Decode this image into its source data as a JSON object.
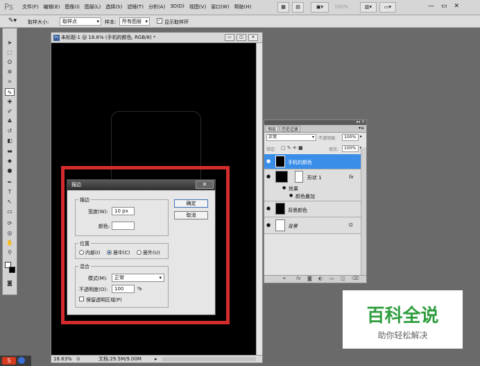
{
  "app": {
    "logo": "Ps"
  },
  "menu": {
    "items": [
      "文件(F)",
      "编辑(E)",
      "图像(I)",
      "图层(L)",
      "选择(S)",
      "滤镜(T)",
      "分析(A)",
      "3D(D)",
      "视图(V)",
      "窗口(W)",
      "帮助(H)"
    ],
    "zoom": "100%",
    "min_icon": "—",
    "max_icon": "▭",
    "close_icon": "✕"
  },
  "options": {
    "sample_size_label": "取样大小:",
    "sample_size_value": "取样点",
    "sample_label": "样本:",
    "sample_value": "所有图层",
    "show_ring_label": "显示取样环"
  },
  "document": {
    "title": "未标题-1 @ 18.6% (手机的颜色, RGB/8) *",
    "ps_badge": "Ps",
    "zoom": "18.63%",
    "doc_size": "文档:29.5M/9.00M"
  },
  "dialog": {
    "title": "描边",
    "close_icon": "✕",
    "stroke_group": "描边",
    "width_label": "宽度(W):",
    "width_value": "10 px",
    "color_label": "颜色:",
    "position_group": "位置",
    "position_options": [
      "内部(I)",
      "居中(C)",
      "居外(U)"
    ],
    "blend_group": "混合",
    "mode_label": "模式(M):",
    "mode_value": "正常",
    "opacity_label": "不透明度(O):",
    "opacity_value": "100",
    "opacity_unit": "%",
    "preserve_label": "保留透明区域(P)",
    "ok_label": "确定",
    "cancel_label": "取消",
    "stroke_color": "#ffffff"
  },
  "layers_panel": {
    "tabs": [
      "图层",
      "历史记录"
    ],
    "blend_mode": "正常",
    "opacity_label": "不透明度:",
    "opacity_value": "100%",
    "lock_label": "锁定:",
    "fill_label": "填充:",
    "fill_value": "100%",
    "layers": [
      "手机的颜色",
      "形状 1",
      "效果",
      "颜色叠加",
      "背景颜色",
      "背景"
    ],
    "fx_label": "fx",
    "lock_icon": "🔒"
  },
  "watermark": {
    "main": "百科全说",
    "sub": "助你轻松解决"
  },
  "colors": {
    "accent": "#3a8ee8",
    "highlight": "#d42c2c",
    "watermark_green": "#2f9e3f"
  }
}
